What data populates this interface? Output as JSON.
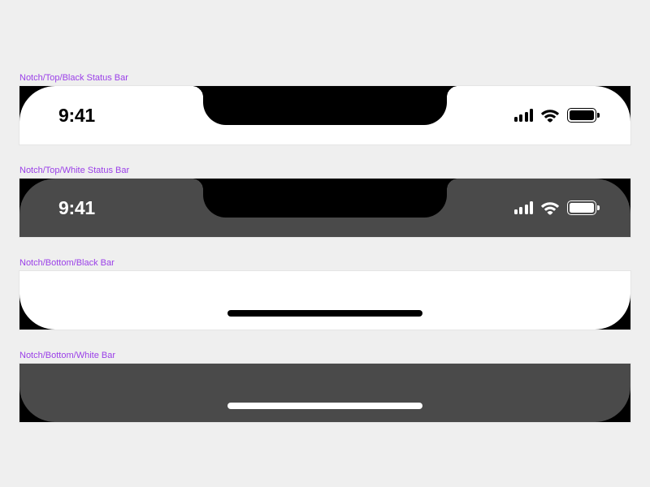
{
  "labels": {
    "top_black": "Notch/Top/Black Status Bar",
    "top_white": "Notch/Top/White Status Bar",
    "bottom_black": "Notch/Bottom/Black Bar",
    "bottom_white": "Notch/Bottom/White Bar"
  },
  "status": {
    "time": "9:41"
  },
  "icons": {
    "cellular": "cellular-icon",
    "wifi": "wifi-icon",
    "battery": "battery-icon"
  }
}
